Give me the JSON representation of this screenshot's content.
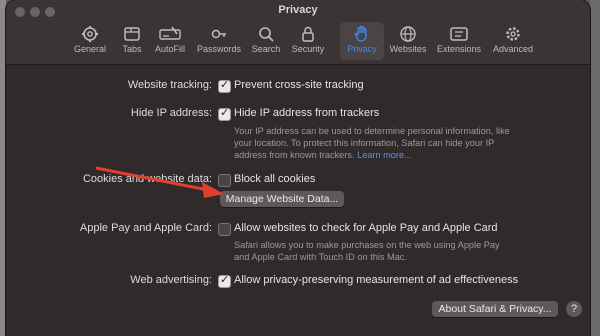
{
  "window": {
    "title": "Privacy"
  },
  "tabs": [
    {
      "label": "General",
      "icon": "gear-icon"
    },
    {
      "label": "Tabs",
      "icon": "tabs-icon"
    },
    {
      "label": "AutoFill",
      "icon": "autofill-icon"
    },
    {
      "label": "Passwords",
      "icon": "key-icon"
    },
    {
      "label": "Search",
      "icon": "search-icon"
    },
    {
      "label": "Security",
      "icon": "lock-icon"
    },
    {
      "label": "Privacy",
      "icon": "hand-icon"
    },
    {
      "label": "Websites",
      "icon": "globe-icon"
    },
    {
      "label": "Extensions",
      "icon": "puzzle-icon"
    },
    {
      "label": "Advanced",
      "icon": "advanced-gear-icon"
    }
  ],
  "settings": {
    "tracking": {
      "label": "Website tracking:",
      "option": "Prevent cross-site tracking",
      "checked": true
    },
    "hide_ip": {
      "label": "Hide IP address:",
      "option": "Hide IP address from trackers",
      "checked": true,
      "desc_line1": "Your IP address can be used to determine personal information, like",
      "desc_line2": "your location. To protect this information, Safari can hide your IP",
      "desc_line3": "address from known trackers.",
      "learn_more": "Learn more..."
    },
    "cookies": {
      "label": "Cookies and website data:",
      "option": "Block all cookies",
      "checked": false,
      "manage_button": "Manage Website Data..."
    },
    "apple_pay": {
      "label": "Apple Pay and Apple Card:",
      "option": "Allow websites to check for Apple Pay and Apple Card",
      "checked": false,
      "desc_line1": "Safari allows you to make purchases on the web using Apple Pay",
      "desc_line2": "and Apple Card with Touch ID on this Mac."
    },
    "advertising": {
      "label": "Web advertising:",
      "option": "Allow privacy-preserving measurement of ad effectiveness",
      "checked": true
    }
  },
  "footer": {
    "about_button": "About Safari & Privacy...",
    "help": "?"
  },
  "colors": {
    "accent": "#3b8cf5",
    "annotation_arrow": "#e0402e",
    "window_bg": "#302a2a"
  }
}
